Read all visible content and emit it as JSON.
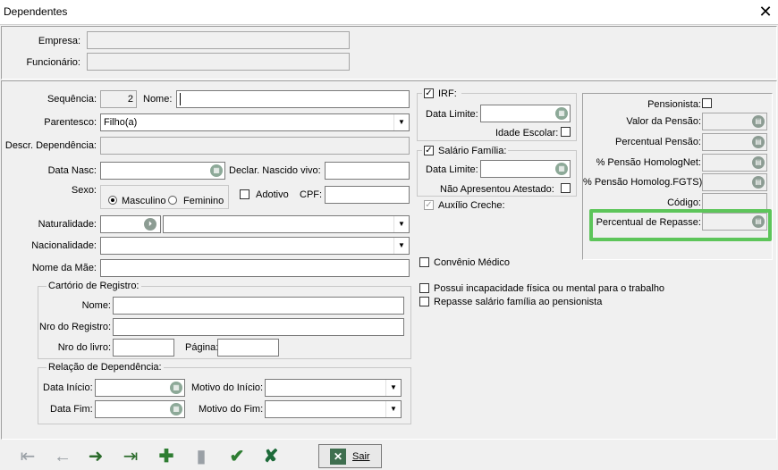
{
  "window": {
    "title": "Dependentes",
    "close_glyph": "✕"
  },
  "header": {
    "empresa_label": "Empresa:",
    "funcionario_label": "Funcionário:"
  },
  "form": {
    "sequencia_label": "Sequência:",
    "sequencia_value": "2",
    "nome_label": "Nome:",
    "nome_value": "",
    "parentesco_label": "Parentesco:",
    "parentesco_value": "Filho(a)",
    "descr_dependencia_label": "Descr. Dependência:",
    "data_nasc_label": "Data Nasc:",
    "declar_nascido_vivo_label": "Declar. Nascido vivo:",
    "sexo_label": "Sexo:",
    "masculino_label": "Masculino",
    "feminino_label": "Feminino",
    "adotivo_label": "Adotivo",
    "cpf_label": "CPF:",
    "naturalidade_label": "Naturalidade:",
    "nacionalidade_label": "Nacionalidade:",
    "nome_mae_label": "Nome da Mãe:",
    "convenio_medico_label": "Convênio Médico",
    "incapacidade_label": "Possui incapacidade física ou mental  para o trabalho",
    "repasse_salario_label": "Repasse salário família ao pensionista"
  },
  "cartorio": {
    "title": "Cartório de Registro:",
    "nome_label": "Nome:",
    "nro_registro_label": "Nro do Registro:",
    "nro_livro_label": "Nro do livro:",
    "pagina_label": "Página:"
  },
  "relacao": {
    "title": "Relação de Dependência:",
    "data_inicio_label": "Data Início:",
    "motivo_inicio_label": "Motivo do Início:",
    "data_fim_label": "Data Fim:",
    "motivo_fim_label": "Motivo do Fim:"
  },
  "irf": {
    "title": "IRF:",
    "checked": true,
    "data_limite_label": "Data Limite:",
    "idade_escolar_label": "Idade Escolar:"
  },
  "salario_familia": {
    "title": "Salário Família:",
    "checked": true,
    "data_limite_label": "Data Limite:",
    "nao_apresentou_label": "Não Apresentou Atestado:"
  },
  "auxilio_creche_label": "Auxílio Creche:",
  "pensao": {
    "pensionista_label": "Pensionista:",
    "valor_pensao_label": "Valor da Pensão:",
    "percentual_pensao_label": "Percentual Pensão:",
    "pensao_homolognet_label": "% Pensão HomologNet:",
    "pensao_homolog_fgts_label": "% Pensão Homolog.FGTS):",
    "codigo_label": "Código:",
    "percentual_repasse_label": "Percentual de Repasse:"
  },
  "toolbar": {
    "first_glyph": "⇤",
    "prev_glyph": "←",
    "next_glyph": "➜",
    "last_glyph": "⇥",
    "add_glyph": "✚",
    "delete_glyph": "▮",
    "confirm_glyph": "✔",
    "cancel_glyph": "✘",
    "sair_label": "Sair"
  },
  "colors": {
    "highlight": "#5dc55a",
    "calendar_icon": "#8da998"
  }
}
